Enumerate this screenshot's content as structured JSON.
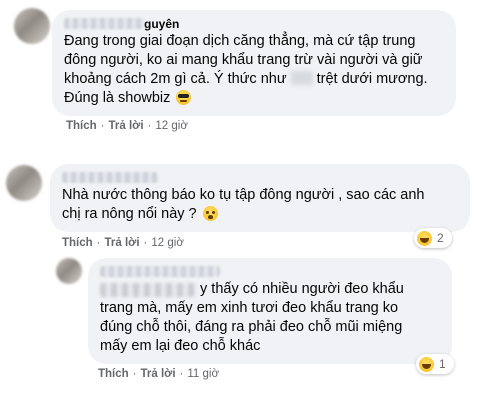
{
  "comments": [
    {
      "author_suffix": "guyên",
      "line1": "Đang trong giai đoạn dịch căng thẳng, mà cứ tập trung",
      "line2": "đông người, ko ai mang khẩu trang trừ vài người và giữ",
      "line3a": "khoảng cách 2m gì cả. Ý thức như ",
      "line3b": " trệt dưới mương.",
      "line4": "Đúng là showbiz",
      "emoji": "sunglasses-emoji",
      "like": "Thích",
      "reply": "Trả lời",
      "time": "12 giờ"
    },
    {
      "line1": "Nhà nước thông báo ko tụ tập đông người , sao các anh",
      "line2": "chị ra nông nổi này ?",
      "emoji": "crying-emoji",
      "like": "Thích",
      "reply": "Trả lời",
      "time": "12 giờ",
      "reaction_icon": "haha-reaction-icon",
      "reaction_count": "2"
    },
    {
      "line1": "y thấy có nhiều người đeo khẩu",
      "line2": "trang mà, mấy em xinh tươi đeo khẩu trang ko",
      "line3": "đúng chỗ thôi, đáng ra phải đeo chỗ mũi miệng",
      "line4": "mấy em lại đeo chỗ khác",
      "like": "Thích",
      "reply": "Trả lời",
      "time": "11 giờ",
      "reaction_icon": "haha-reaction-icon",
      "reaction_count": "1"
    }
  ],
  "separator": "·"
}
